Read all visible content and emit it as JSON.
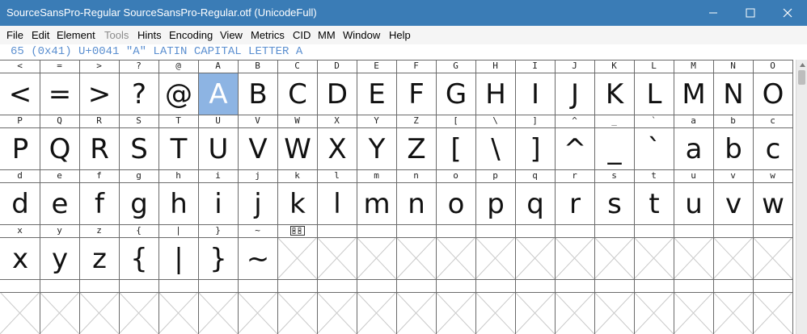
{
  "window": {
    "title": "SourceSansPro-Regular  SourceSansPro-Regular.otf (UnicodeFull)"
  },
  "titlebar_buttons": {
    "minimize_icon": "minimize-icon",
    "maximize_icon": "maximize-icon",
    "close_icon": "close-icon"
  },
  "menu": {
    "items": [
      {
        "label": "File",
        "disabled": false
      },
      {
        "label": "Edit",
        "disabled": false
      },
      {
        "label": "Element",
        "disabled": false
      },
      {
        "label": "Tools",
        "disabled": true
      },
      {
        "label": "Hints",
        "disabled": false
      },
      {
        "label": "Encoding",
        "disabled": false
      },
      {
        "label": "View",
        "disabled": false
      },
      {
        "label": "Metrics",
        "disabled": false
      },
      {
        "label": "CID",
        "disabled": false
      },
      {
        "label": "MM",
        "disabled": false
      },
      {
        "label": "Window",
        "disabled": false
      },
      {
        "label": "Help",
        "disabled": false
      }
    ]
  },
  "info_line": "65 (0x41) U+0041 \"A\" LATIN CAPITAL LETTER A",
  "grid": {
    "selected_glyph": "A",
    "rows": [
      [
        "<",
        "=",
        ">",
        "?",
        "@",
        "A",
        "B",
        "C",
        "D",
        "E",
        "F",
        "G",
        "H",
        "I",
        "J",
        "K",
        "L",
        "M",
        "N",
        "O"
      ],
      [
        "P",
        "Q",
        "R",
        "S",
        "T",
        "U",
        "V",
        "W",
        "X",
        "Y",
        "Z",
        "[",
        "\\",
        "]",
        "^",
        "_",
        "`",
        "a",
        "b",
        "c"
      ],
      [
        "d",
        "e",
        "f",
        "g",
        "h",
        "i",
        "j",
        "k",
        "l",
        "m",
        "n",
        "o",
        "p",
        "q",
        "r",
        "s",
        "t",
        "u",
        "v",
        "w"
      ],
      [
        "x",
        "y",
        "z",
        "{",
        "|",
        "}",
        "~",
        "",
        "",
        "",
        "",
        "",
        "",
        "",
        "",
        "",
        "",
        "",
        "",
        ""
      ],
      [
        "",
        "",
        "",
        "",
        "",
        "",
        "",
        "",
        "",
        "",
        "",
        "",
        "",
        "",
        "",
        "",
        "",
        "",
        "",
        ""
      ]
    ],
    "row3_col7_label_icon": "unicode-box-icon"
  },
  "colors": {
    "titlebar": "#3a7cb6",
    "selection": "#8db4e3",
    "info_text": "#5b8fd0"
  }
}
